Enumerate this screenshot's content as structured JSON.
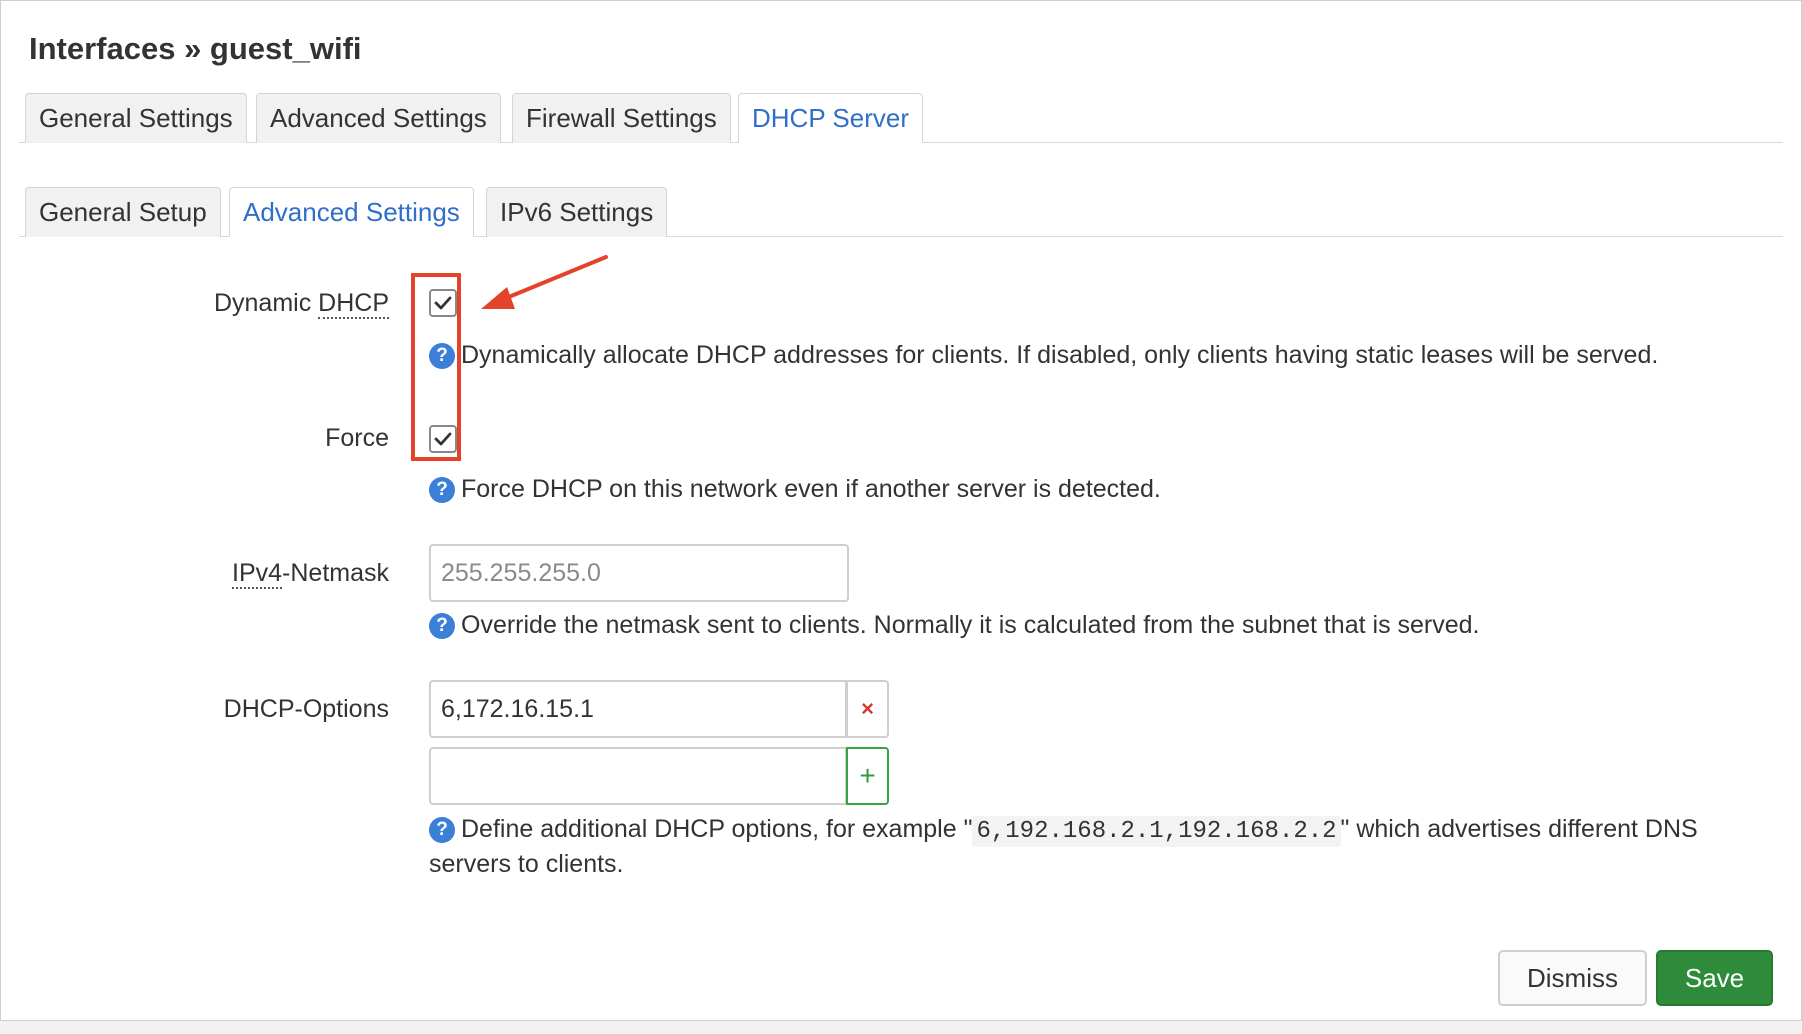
{
  "title": "Interfaces » guest_wifi",
  "main_tabs": [
    {
      "label": "General Settings",
      "active": false
    },
    {
      "label": "Advanced Settings",
      "active": false
    },
    {
      "label": "Firewall Settings",
      "active": false
    },
    {
      "label": "DHCP Server",
      "active": true
    }
  ],
  "sub_tabs": [
    {
      "label": "General Setup",
      "active": false
    },
    {
      "label": "Advanced Settings",
      "active": true
    },
    {
      "label": "IPv6 Settings",
      "active": false
    }
  ],
  "fields": {
    "dynamic_dhcp": {
      "label_prefix": "Dynamic ",
      "label_abbr": "DHCP",
      "checked": true,
      "help": "Dynamically allocate DHCP addresses for clients. If disabled, only clients having static leases will be served."
    },
    "force": {
      "label": "Force",
      "checked": true,
      "help": "Force DHCP on this network even if another server is detected."
    },
    "netmask": {
      "label_abbr": "IPv4",
      "label_suffix": "-Netmask",
      "placeholder": "255.255.255.0",
      "help": "Override the netmask sent to clients. Normally it is calculated from the subnet that is served."
    },
    "dhcp_options": {
      "label": "DHCP-Options",
      "values": [
        "6,172.16.15.1"
      ],
      "new_value": "",
      "help_prefix": "Define additional DHCP options, for example \"",
      "help_code": "6,192.168.2.1,192.168.2.2",
      "help_suffix": "\" which advertises different DNS servers to clients."
    }
  },
  "buttons": {
    "dismiss": "Dismiss",
    "save": "Save"
  },
  "icons": {
    "remove": "×",
    "add": "+",
    "help": "?"
  },
  "colors": {
    "accent": "#2f6fc9",
    "save": "#2e8b3a",
    "highlight": "#e4432b"
  }
}
